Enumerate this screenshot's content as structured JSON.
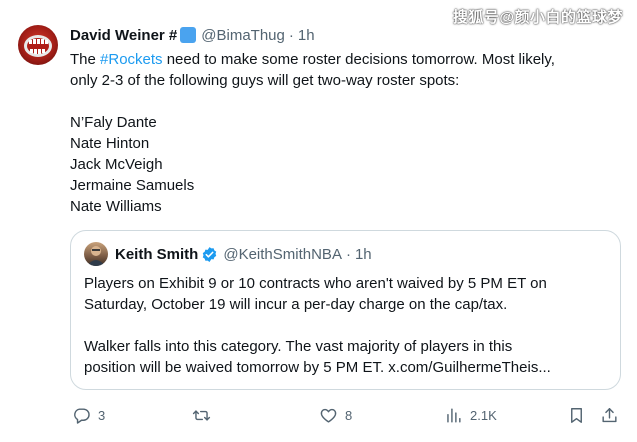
{
  "watermark": "搜狐号@颜小白的篮球梦",
  "tweet": {
    "display_name": "David Weiner #",
    "handle": "@BimaThug",
    "separator": "·",
    "time": "1h",
    "line1_pre": "The ",
    "hashtag": "#Rockets",
    "line1_post": " need to make some roster decisions tomorrow. Most likely,",
    "line2": "only 2-3 of the following guys will get two-way roster spots:",
    "players": [
      "N’Faly Dante",
      "Nate Hinton",
      "Jack McVeigh",
      "Jermaine Samuels",
      "Nate Williams"
    ]
  },
  "quote": {
    "display_name": "Keith Smith",
    "handle": "@KeithSmithNBA",
    "separator": "·",
    "time": "1h",
    "lines": [
      "Players on Exhibit 9 or 10 contracts who aren't waived by 5 PM ET on",
      "Saturday, October 19 will incur a per-day charge on the cap/tax.",
      "",
      "Walker falls into this category. The vast majority of players in this",
      "position will be waived tomorrow by 5 PM ET. x.com/GuilhermeTheis..."
    ]
  },
  "actions": {
    "replies": "3",
    "reposts": "",
    "likes": "8",
    "views": "2.1K"
  },
  "colors": {
    "link": "#1d9bf0",
    "muted": "#536471",
    "text": "#0f1419",
    "border": "#cfd9de"
  }
}
